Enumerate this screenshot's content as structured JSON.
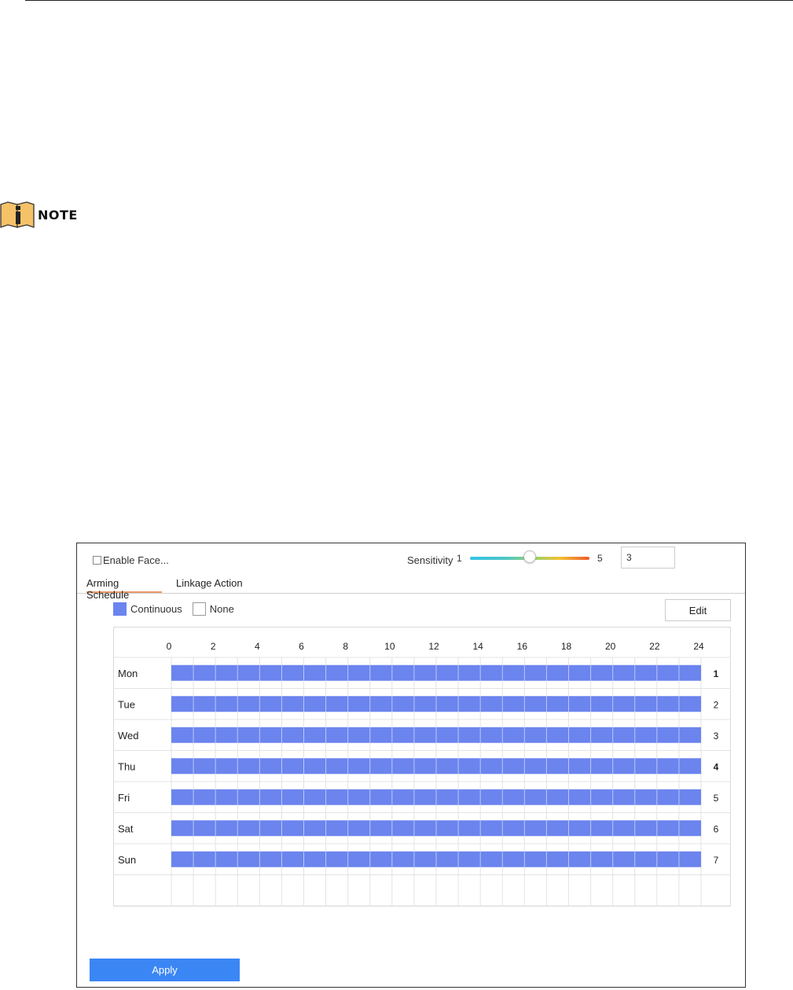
{
  "note": {
    "label": "NOTE",
    "icon": "info-book-icon"
  },
  "face_panel": {
    "enable_label": "Enable Face...",
    "enable_checked": false,
    "sensitivity": {
      "label": "Sensitivity",
      "min_label": "1",
      "max_label": "5",
      "value": "3",
      "level": 3
    },
    "tabs": [
      {
        "label": "Arming Schedule",
        "active": true
      },
      {
        "label": "Linkage Action",
        "active": false
      }
    ],
    "legend": {
      "continuous_label": "Continuous",
      "none_label": "None"
    },
    "edit_label": "Edit",
    "apply_label": "Apply",
    "colors": {
      "continuous": "#6b84ee",
      "apply_button": "#3b86f5",
      "active_tab_underline": "#e89a6a"
    },
    "schedule": {
      "hour_labels": [
        "0",
        "2",
        "4",
        "6",
        "8",
        "10",
        "12",
        "14",
        "16",
        "18",
        "20",
        "22",
        "24"
      ],
      "days": [
        {
          "name": "Mon",
          "number": "1",
          "bold": true,
          "start": 0,
          "end": 24,
          "type": "continuous"
        },
        {
          "name": "Tue",
          "number": "2",
          "bold": false,
          "start": 0,
          "end": 24,
          "type": "continuous"
        },
        {
          "name": "Wed",
          "number": "3",
          "bold": false,
          "start": 0,
          "end": 24,
          "type": "continuous"
        },
        {
          "name": "Thu",
          "number": "4",
          "bold": true,
          "start": 0,
          "end": 24,
          "type": "continuous"
        },
        {
          "name": "Fri",
          "number": "5",
          "bold": false,
          "start": 0,
          "end": 24,
          "type": "continuous"
        },
        {
          "name": "Sat",
          "number": "6",
          "bold": false,
          "start": 0,
          "end": 24,
          "type": "continuous"
        },
        {
          "name": "Sun",
          "number": "7",
          "bold": false,
          "start": 0,
          "end": 24,
          "type": "continuous"
        }
      ]
    }
  }
}
